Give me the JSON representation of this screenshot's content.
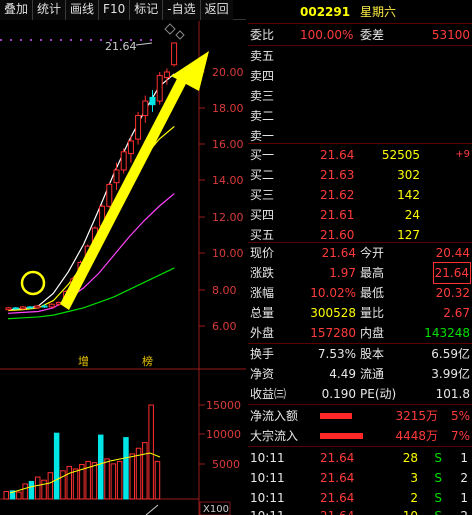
{
  "toolbar": {
    "items": [
      "叠加",
      "统计",
      "画线",
      "F10",
      "标记",
      "-自选",
      "返回"
    ]
  },
  "chart": {
    "peak_label": "21.64",
    "price_ticks": [
      "20.00",
      "18.00",
      "16.00",
      "14.00",
      "12.00",
      "10.00",
      "8.00",
      "6.00"
    ],
    "volume_ticks": [
      "15000",
      "10000",
      "5000"
    ],
    "volume_unit": "X100",
    "tag_zeng": "增",
    "tag_bang": "榜",
    "colors": {
      "up": "#ff3030",
      "down": "#00e5e5",
      "ma5": "#ffffff",
      "ma10": "#ffff00",
      "ma20": "#ff44ff",
      "ma60": "#00dd00",
      "arrow": "#ffff00"
    }
  },
  "header": {
    "code": "002291",
    "name": "星期六"
  },
  "ratio": {
    "weibi_label": "委比",
    "weibi_value": "100.00%",
    "weicha_label": "委差",
    "weicha_value": "53100"
  },
  "sell": [
    {
      "label": "卖五"
    },
    {
      "label": "卖四"
    },
    {
      "label": "卖三"
    },
    {
      "label": "卖二"
    },
    {
      "label": "卖一"
    }
  ],
  "buy": [
    {
      "label": "买一",
      "price": "21.64",
      "vol": "52505",
      "chg": "+9"
    },
    {
      "label": "买二",
      "price": "21.63",
      "vol": "302",
      "chg": ""
    },
    {
      "label": "买三",
      "price": "21.62",
      "vol": "142",
      "chg": ""
    },
    {
      "label": "买四",
      "price": "21.61",
      "vol": "24",
      "chg": ""
    },
    {
      "label": "买五",
      "price": "21.60",
      "vol": "127",
      "chg": ""
    }
  ],
  "quote": {
    "xianjia_label": "现价",
    "xianjia": "21.64",
    "jinkai_label": "今开",
    "jinkai": "20.44",
    "zhangdie_label": "涨跌",
    "zhangdie": "1.97",
    "zuigao_label": "最高",
    "zuigao": "21.64",
    "zhangfu_label": "涨幅",
    "zhangfu": "10.02%",
    "zuidi_label": "最低",
    "zuidi": "20.32",
    "zongliang_label": "总量",
    "zongliang": "300528",
    "liangbi_label": "量比",
    "liangbi": "2.67",
    "waipan_label": "外盘",
    "waipan": "157280",
    "neipan_label": "内盘",
    "neipan": "143248"
  },
  "fundamentals": {
    "huanshou_label": "换手",
    "huanshou": "7.53%",
    "guben_label": "股本",
    "guben": "6.59亿",
    "jingzi_label": "净资",
    "jingzi": "4.49",
    "liutong_label": "流通",
    "liutong": "3.99亿",
    "shouyi_label": "收益㈢",
    "shouyi": "0.190",
    "pe_label": "PE(动)",
    "pe": "101.8"
  },
  "flow": {
    "net_label": "净流入额",
    "net_value": "3215万",
    "net_pct": "5%",
    "net_bar": 0.45,
    "big_label": "大宗流入",
    "big_value": "4448万",
    "big_pct": "7%",
    "big_bar": 0.62
  },
  "ticks": [
    {
      "time": "10:11",
      "price": "21.64",
      "vol": "28",
      "side": "S",
      "num": "1"
    },
    {
      "time": "10:11",
      "price": "21.64",
      "vol": "3",
      "side": "S",
      "num": "2"
    },
    {
      "time": "10:11",
      "price": "21.64",
      "vol": "2",
      "side": "S",
      "num": "1"
    },
    {
      "time": "10:11",
      "price": "21.64",
      "vol": "10",
      "side": "S",
      "num": "2"
    }
  ]
}
